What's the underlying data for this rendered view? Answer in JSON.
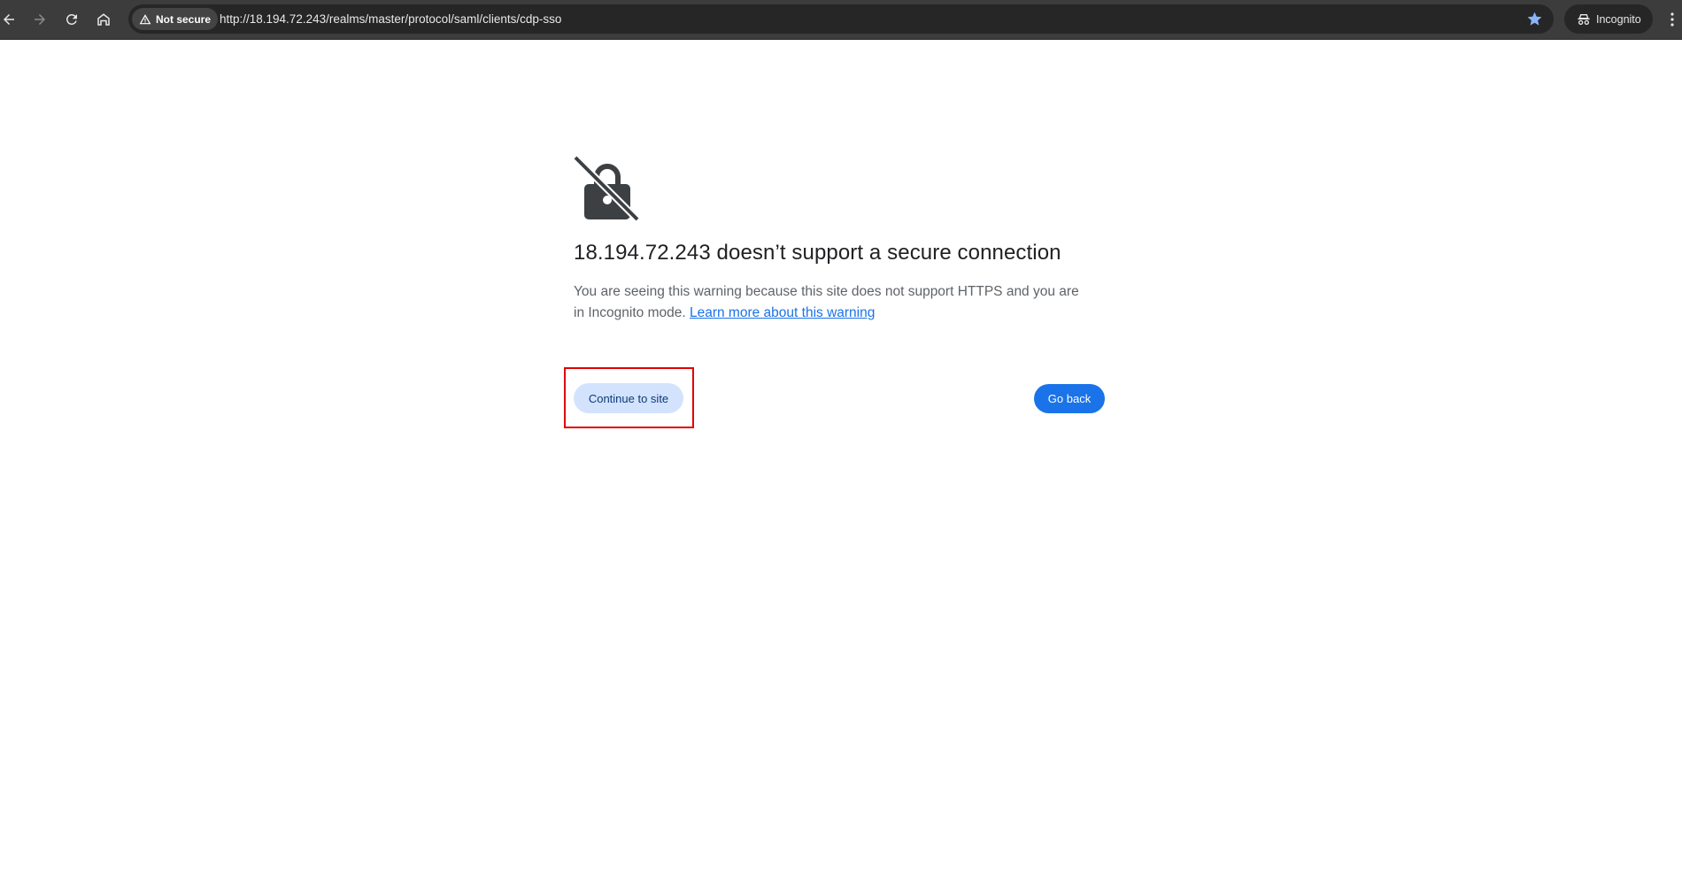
{
  "browser": {
    "security_label": "Not secure",
    "url": "http://18.194.72.243/realms/master/protocol/saml/clients/cdp-sso",
    "incognito_label": "Incognito",
    "icons": [
      "back-arrow-icon",
      "forward-arrow-icon",
      "reload-icon",
      "home-icon",
      "warning-triangle-icon",
      "star-icon",
      "incognito-icon",
      "more-menu-icon"
    ]
  },
  "page": {
    "icon": "lock-crossed-icon",
    "title": "18.194.72.243 doesn’t support a secure connection",
    "description": "You are seeing this warning because this site does not support HTTPS and you are in Incognito mode.",
    "learn_more_link": "Learn more about this warning",
    "continue_button": "Continue to site",
    "go_back_button": "Go back"
  },
  "colors": {
    "primary_button": "#1a73e8",
    "secondary_button": "#d3e3fd",
    "highlight_box": "#e00000",
    "toolbar": "#3c3c3c"
  }
}
